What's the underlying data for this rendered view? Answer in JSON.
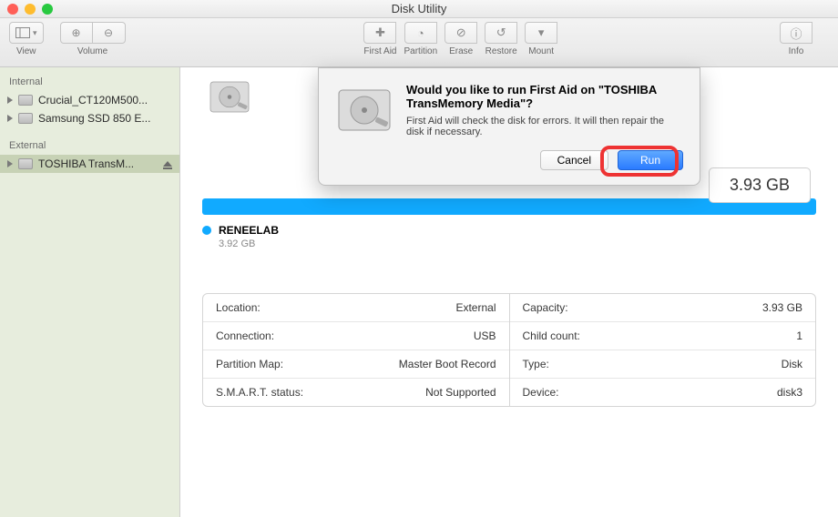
{
  "window": {
    "title": "Disk Utility"
  },
  "toolbar": {
    "view_label": "View",
    "volume_label": "Volume",
    "firstaid_label": "First Aid",
    "partition_label": "Partition",
    "erase_label": "Erase",
    "restore_label": "Restore",
    "mount_label": "Mount",
    "info_label": "Info"
  },
  "sidebar": {
    "internal_label": "Internal",
    "external_label": "External",
    "internal": [
      {
        "name": "Crucial_CT120M500..."
      },
      {
        "name": "Samsung SSD 850 E..."
      }
    ],
    "external": [
      {
        "name": "TOSHIBA TransM..."
      }
    ]
  },
  "disk": {
    "capacity_badge": "3.93 GB",
    "volume_name": "RENEELAB",
    "volume_size": "3.92 GB"
  },
  "info_left": {
    "location_k": "Location:",
    "location_v": "External",
    "connection_k": "Connection:",
    "connection_v": "USB",
    "pmap_k": "Partition Map:",
    "pmap_v": "Master Boot Record",
    "smart_k": "S.M.A.R.T. status:",
    "smart_v": "Not Supported"
  },
  "info_right": {
    "capacity_k": "Capacity:",
    "capacity_v": "3.93 GB",
    "child_k": "Child count:",
    "child_v": "1",
    "type_k": "Type:",
    "type_v": "Disk",
    "device_k": "Device:",
    "device_v": "disk3"
  },
  "dialog": {
    "title": "Would you like to run First Aid on \"TOSHIBA TransMemory Media\"?",
    "message": "First Aid will check the disk for errors. It will then repair the disk if necessary.",
    "cancel": "Cancel",
    "run": "Run"
  }
}
